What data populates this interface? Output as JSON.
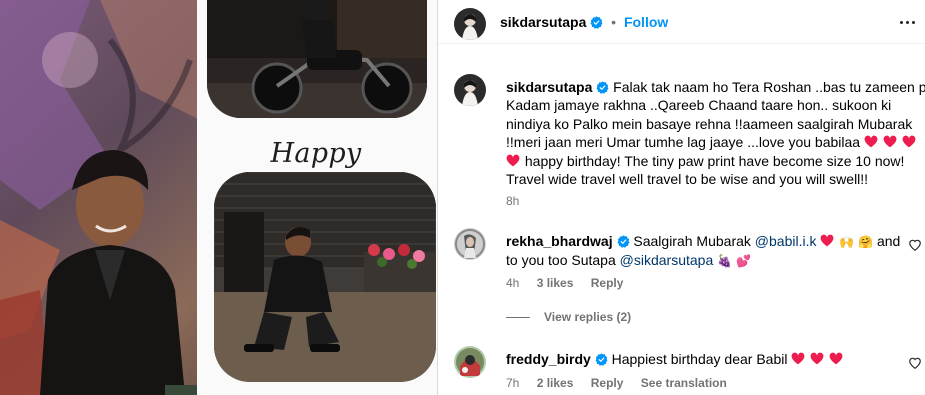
{
  "header": {
    "username": "sikdarsutapa",
    "dot": "•",
    "follow_label": "Follow"
  },
  "post_image": {
    "caption_text": "Happy birthday!!!"
  },
  "caption": {
    "username": "sikdarsutapa",
    "text_lines": [
      "Falak tak naam ho Tera Roshan ..bas tu zameen pe",
      "Kadam jamaye rakhna ..Qareeb Chaand taare hon.. sukoon ki",
      "nindiya ko Palko mein basaye rehna !!aameen saalgirah Mubarak",
      "!!meri jaan meri Umar tumhe lag jaaye ...love you babilaa",
      "happy birthday! The tiny paw print have become size 10 now!",
      "Travel wide travel well travel to be wise and you will swell!!"
    ],
    "time": "8h"
  },
  "comments": [
    {
      "username": "rekha_bhardwaj",
      "text_a": "Saalgirah Mubarak",
      "mention_a": "@babil.i.k",
      "text_b": "and",
      "text_c": "to you too Sutapa",
      "mention_b": "@sikdarsutapa",
      "time": "4h",
      "likes": "3 likes",
      "reply": "Reply",
      "view_replies": "View replies (2)"
    },
    {
      "username": "freddy_birdy",
      "text": "Happiest birthday dear Babil",
      "time": "7h",
      "likes": "2 likes",
      "reply": "Reply",
      "see_translation": "See translation"
    }
  ],
  "colors": {
    "accent": "#0095f6",
    "verified": "#0095f6",
    "heart": "#ed1d4f",
    "muted": "#737373",
    "mention": "#00376b"
  },
  "icons": [
    "verified-badge-icon",
    "more-options-icon",
    "heart-like-icon",
    "heart-emoji-icon"
  ]
}
